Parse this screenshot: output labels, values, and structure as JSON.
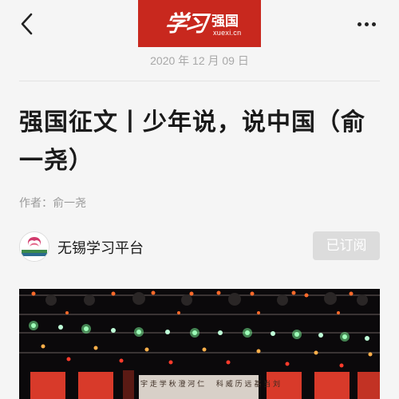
{
  "header": {
    "logo_brush_text": "学习",
    "logo_cn": "强国",
    "logo_en": "xuexi.cn",
    "back_icon": "chevron-left-icon",
    "more_icon": "more-dots-icon"
  },
  "article": {
    "date": "2020 年 12 月 09 日",
    "title": "强国征文丨少年说，说中国（俞一尧）",
    "author": "作者：俞一尧"
  },
  "account": {
    "name": "无锡学习平台",
    "subscribe_label": "已订阅"
  },
  "photo": {
    "stage_text": "宇 走 学 秋 澄 河 仁 　 科 威 历 远 基 当 刘"
  },
  "colors": {
    "brand_red": "#c8281e",
    "background": "#f5f5f5",
    "subscribe_bg": "#dcdcdc"
  }
}
